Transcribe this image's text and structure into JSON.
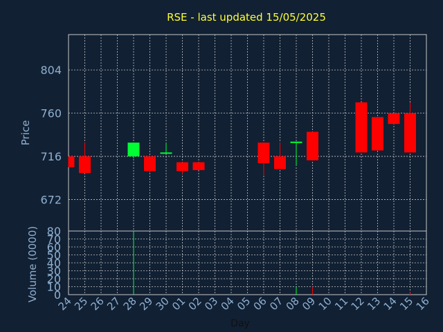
{
  "chart_data": {
    "type": "candlestick",
    "title": "RSE - last updated 15/05/2025",
    "xlabel": "Day",
    "ylabel": "Price",
    "volume_label": "Volume (0000)",
    "categories": [
      "24",
      "25",
      "26",
      "27",
      "28",
      "29",
      "30",
      "01",
      "02",
      "03",
      "04",
      "05",
      "06",
      "07",
      "08",
      "09",
      "10",
      "11",
      "12",
      "13",
      "14",
      "15",
      "16"
    ],
    "price_ticks": [
      672,
      716,
      760,
      804
    ],
    "price_range": [
      640,
      840
    ],
    "volume_ticks": [
      0,
      10,
      20,
      30,
      40,
      50,
      60,
      70,
      80
    ],
    "volume_range": [
      0,
      80
    ],
    "candles": [
      {
        "day": "24",
        "open": 716,
        "close": 705,
        "high": 716,
        "low": 705
      },
      {
        "day": "25",
        "open": 716,
        "close": 699,
        "high": 730,
        "low": 699
      },
      {
        "day": "28",
        "open": 716,
        "close": 730,
        "high": 730,
        "low": 714
      },
      {
        "day": "29",
        "open": 716,
        "close": 701,
        "high": 716,
        "low": 699
      },
      {
        "day": "30",
        "open": 719,
        "close": 720,
        "high": 730,
        "low": 719
      },
      {
        "day": "01",
        "open": 710,
        "close": 701,
        "high": 710,
        "low": 698
      },
      {
        "day": "02",
        "open": 710,
        "close": 702,
        "high": 710,
        "low": 702
      },
      {
        "day": "06",
        "open": 730,
        "close": 709,
        "high": 730,
        "low": 697
      },
      {
        "day": "07",
        "open": 716,
        "close": 703,
        "high": 730,
        "low": 703
      },
      {
        "day": "08",
        "open": 730,
        "close": 731,
        "high": 731,
        "low": 707
      },
      {
        "day": "09",
        "open": 741,
        "close": 712,
        "high": 741,
        "low": 712
      },
      {
        "day": "12",
        "open": 771,
        "close": 720,
        "high": 771,
        "low": 720
      },
      {
        "day": "13",
        "open": 756,
        "close": 722,
        "high": 756,
        "low": 722
      },
      {
        "day": "14",
        "open": 760,
        "close": 749,
        "high": 760,
        "low": 749
      },
      {
        "day": "15",
        "open": 760,
        "close": 720,
        "high": 771,
        "low": 720
      }
    ],
    "volumes": [
      {
        "day": "28",
        "value": 80
      },
      {
        "day": "08",
        "value": 10
      },
      {
        "day": "09",
        "value": 10
      },
      {
        "day": "15",
        "value": 3
      }
    ],
    "colors": {
      "background": "#112033",
      "up": "#00ff33",
      "down": "#ff0000",
      "grid": "#c8c8c8",
      "axis_text": "#8fb0d0",
      "title": "#ffff33",
      "xlabel": "#101010"
    },
    "grid": true
  }
}
